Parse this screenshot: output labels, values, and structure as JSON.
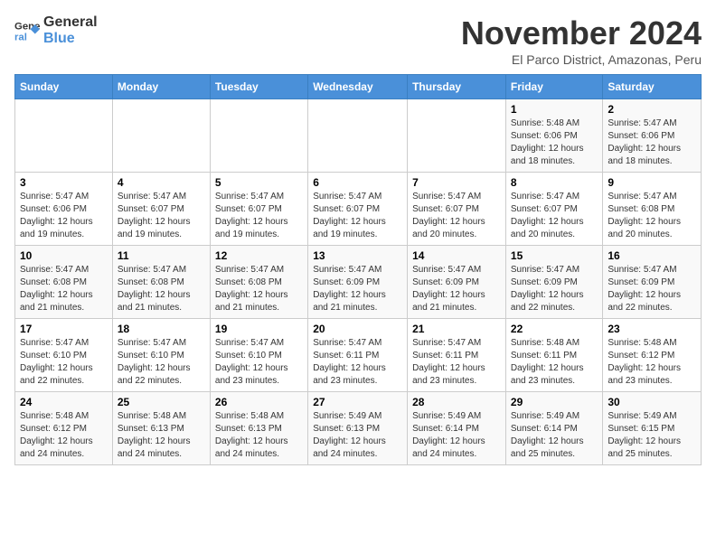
{
  "logo": {
    "line1": "General",
    "line2": "Blue"
  },
  "title": "November 2024",
  "subtitle": "El Parco District, Amazonas, Peru",
  "days_header": [
    "Sunday",
    "Monday",
    "Tuesday",
    "Wednesday",
    "Thursday",
    "Friday",
    "Saturday"
  ],
  "weeks": [
    [
      {
        "day": "",
        "info": ""
      },
      {
        "day": "",
        "info": ""
      },
      {
        "day": "",
        "info": ""
      },
      {
        "day": "",
        "info": ""
      },
      {
        "day": "",
        "info": ""
      },
      {
        "day": "1",
        "info": "Sunrise: 5:48 AM\nSunset: 6:06 PM\nDaylight: 12 hours and 18 minutes."
      },
      {
        "day": "2",
        "info": "Sunrise: 5:47 AM\nSunset: 6:06 PM\nDaylight: 12 hours and 18 minutes."
      }
    ],
    [
      {
        "day": "3",
        "info": "Sunrise: 5:47 AM\nSunset: 6:06 PM\nDaylight: 12 hours and 19 minutes."
      },
      {
        "day": "4",
        "info": "Sunrise: 5:47 AM\nSunset: 6:07 PM\nDaylight: 12 hours and 19 minutes."
      },
      {
        "day": "5",
        "info": "Sunrise: 5:47 AM\nSunset: 6:07 PM\nDaylight: 12 hours and 19 minutes."
      },
      {
        "day": "6",
        "info": "Sunrise: 5:47 AM\nSunset: 6:07 PM\nDaylight: 12 hours and 19 minutes."
      },
      {
        "day": "7",
        "info": "Sunrise: 5:47 AM\nSunset: 6:07 PM\nDaylight: 12 hours and 20 minutes."
      },
      {
        "day": "8",
        "info": "Sunrise: 5:47 AM\nSunset: 6:07 PM\nDaylight: 12 hours and 20 minutes."
      },
      {
        "day": "9",
        "info": "Sunrise: 5:47 AM\nSunset: 6:08 PM\nDaylight: 12 hours and 20 minutes."
      }
    ],
    [
      {
        "day": "10",
        "info": "Sunrise: 5:47 AM\nSunset: 6:08 PM\nDaylight: 12 hours and 21 minutes."
      },
      {
        "day": "11",
        "info": "Sunrise: 5:47 AM\nSunset: 6:08 PM\nDaylight: 12 hours and 21 minutes."
      },
      {
        "day": "12",
        "info": "Sunrise: 5:47 AM\nSunset: 6:08 PM\nDaylight: 12 hours and 21 minutes."
      },
      {
        "day": "13",
        "info": "Sunrise: 5:47 AM\nSunset: 6:09 PM\nDaylight: 12 hours and 21 minutes."
      },
      {
        "day": "14",
        "info": "Sunrise: 5:47 AM\nSunset: 6:09 PM\nDaylight: 12 hours and 21 minutes."
      },
      {
        "day": "15",
        "info": "Sunrise: 5:47 AM\nSunset: 6:09 PM\nDaylight: 12 hours and 22 minutes."
      },
      {
        "day": "16",
        "info": "Sunrise: 5:47 AM\nSunset: 6:09 PM\nDaylight: 12 hours and 22 minutes."
      }
    ],
    [
      {
        "day": "17",
        "info": "Sunrise: 5:47 AM\nSunset: 6:10 PM\nDaylight: 12 hours and 22 minutes."
      },
      {
        "day": "18",
        "info": "Sunrise: 5:47 AM\nSunset: 6:10 PM\nDaylight: 12 hours and 22 minutes."
      },
      {
        "day": "19",
        "info": "Sunrise: 5:47 AM\nSunset: 6:10 PM\nDaylight: 12 hours and 23 minutes."
      },
      {
        "day": "20",
        "info": "Sunrise: 5:47 AM\nSunset: 6:11 PM\nDaylight: 12 hours and 23 minutes."
      },
      {
        "day": "21",
        "info": "Sunrise: 5:47 AM\nSunset: 6:11 PM\nDaylight: 12 hours and 23 minutes."
      },
      {
        "day": "22",
        "info": "Sunrise: 5:48 AM\nSunset: 6:11 PM\nDaylight: 12 hours and 23 minutes."
      },
      {
        "day": "23",
        "info": "Sunrise: 5:48 AM\nSunset: 6:12 PM\nDaylight: 12 hours and 23 minutes."
      }
    ],
    [
      {
        "day": "24",
        "info": "Sunrise: 5:48 AM\nSunset: 6:12 PM\nDaylight: 12 hours and 24 minutes."
      },
      {
        "day": "25",
        "info": "Sunrise: 5:48 AM\nSunset: 6:13 PM\nDaylight: 12 hours and 24 minutes."
      },
      {
        "day": "26",
        "info": "Sunrise: 5:48 AM\nSunset: 6:13 PM\nDaylight: 12 hours and 24 minutes."
      },
      {
        "day": "27",
        "info": "Sunrise: 5:49 AM\nSunset: 6:13 PM\nDaylight: 12 hours and 24 minutes."
      },
      {
        "day": "28",
        "info": "Sunrise: 5:49 AM\nSunset: 6:14 PM\nDaylight: 12 hours and 24 minutes."
      },
      {
        "day": "29",
        "info": "Sunrise: 5:49 AM\nSunset: 6:14 PM\nDaylight: 12 hours and 25 minutes."
      },
      {
        "day": "30",
        "info": "Sunrise: 5:49 AM\nSunset: 6:15 PM\nDaylight: 12 hours and 25 minutes."
      }
    ]
  ]
}
